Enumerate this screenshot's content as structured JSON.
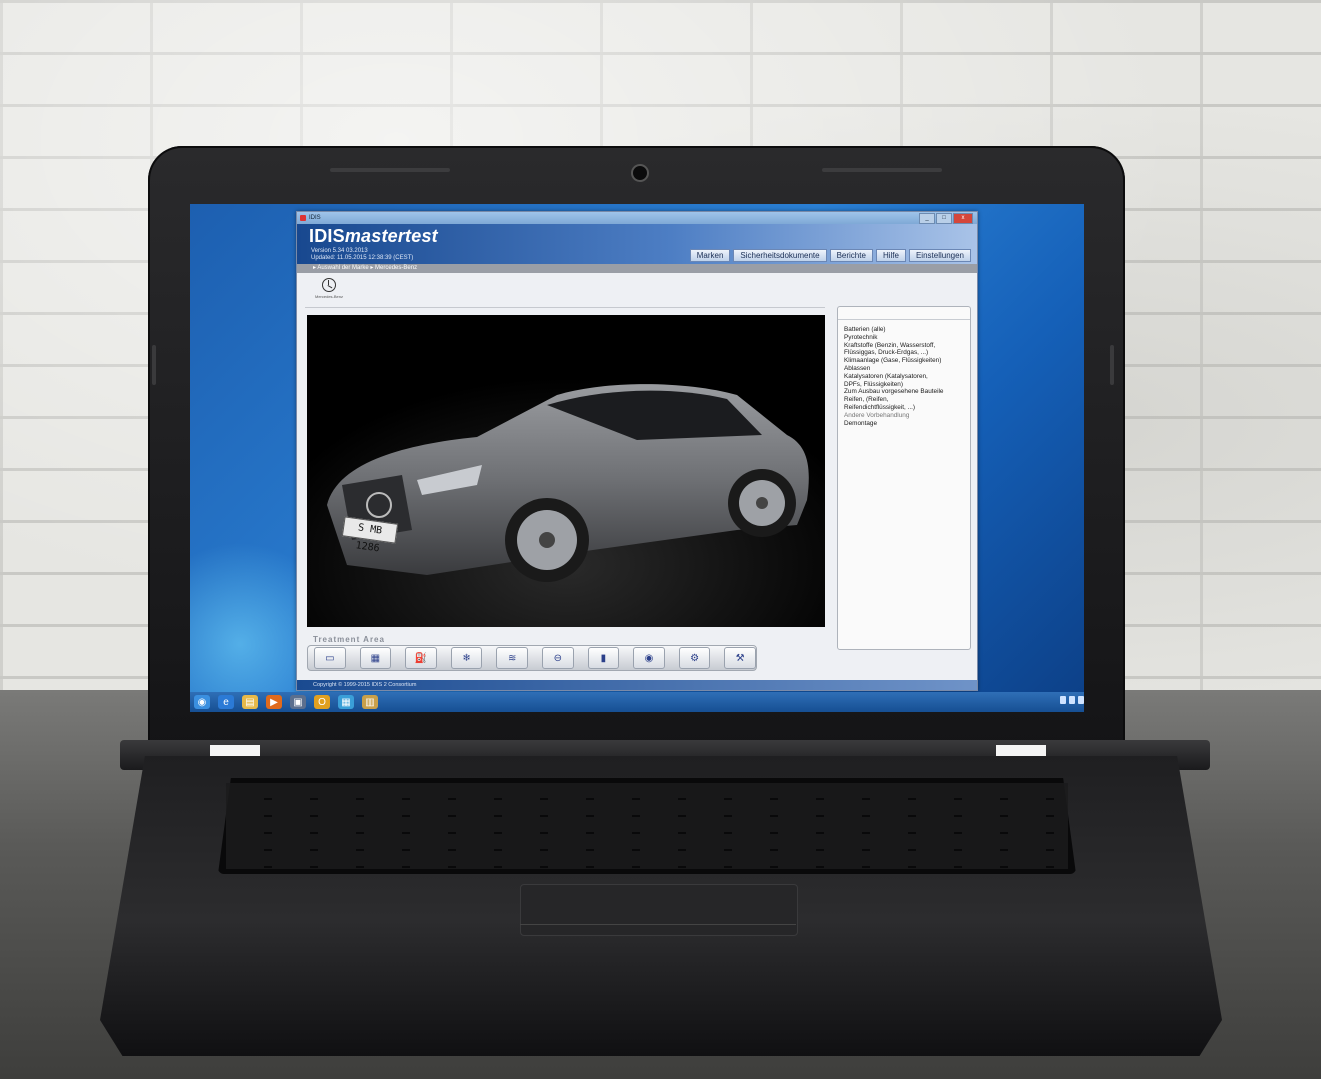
{
  "app": {
    "window_title": "IDIS",
    "brand_bold": "IDIS",
    "brand_italic": "mastertest",
    "version": "Version 5.34 03.2013",
    "updated": "Updated: 11.05.2015 12:38:39 (CEST)",
    "min_label": "_",
    "max_label": "□",
    "close_label": "x"
  },
  "menu": {
    "items": [
      "Marken",
      "Sicherheitsdokumente",
      "Berichte",
      "Hilfe",
      "Einstellungen"
    ]
  },
  "breadcrumb": "▸ Auswahl der Marke ▸ Mercedes-Benz",
  "brand_logo": {
    "label": "Mercedes-Benz",
    "icon": "mercedes-star-icon"
  },
  "car_image": {
    "plate": "S MB 1286"
  },
  "list": {
    "items": [
      "Batterien (alle)",
      "Pyrotechnik",
      "Kraftstoffe (Benzin, Wasserstoff,",
      "Flüssiggas, Druck-Erdgas, ...)",
      "Klimaanlage (Gase, Flüssigkeiten)",
      "Ablassen",
      "Katalysatoren (Katalysatoren,",
      "DPFs, Flüssigkeiten)",
      "Zum Ausbau vorgesehene Bauteile",
      "Reifen, (Reifen,",
      "Reifendichtflüssigkeit, ...)",
      "Andere Vorbehandlung",
      "Demontage"
    ],
    "dim_index": 11
  },
  "treatment": {
    "label": "Treatment Area",
    "buttons": [
      {
        "icon": "battery-icon",
        "glyph": "▭"
      },
      {
        "icon": "catalyst-icon",
        "glyph": "▦"
      },
      {
        "icon": "fuel-icon",
        "glyph": "⛽"
      },
      {
        "icon": "ac-icon",
        "glyph": "❄"
      },
      {
        "icon": "oil-can-icon",
        "glyph": "≋"
      },
      {
        "icon": "drain-icon",
        "glyph": "⊖"
      },
      {
        "icon": "pyro-icon",
        "glyph": "▮"
      },
      {
        "icon": "tire-icon",
        "glyph": "◉"
      },
      {
        "icon": "parts-icon",
        "glyph": "⚙"
      },
      {
        "icon": "wrench-icon",
        "glyph": "⚒"
      }
    ]
  },
  "footer": "Copyright © 1999-2015 IDIS 2 Consortium",
  "taskbar": {
    "icons": [
      "start-orb-icon",
      "ie-icon",
      "folder-icon",
      "media-player-icon",
      "app-icon",
      "outlook-icon",
      "network-icon",
      "idis-icon"
    ],
    "glyphs": [
      "◉",
      "e",
      "▤",
      "▶",
      "▣",
      "O",
      "▦",
      "▥"
    ]
  }
}
